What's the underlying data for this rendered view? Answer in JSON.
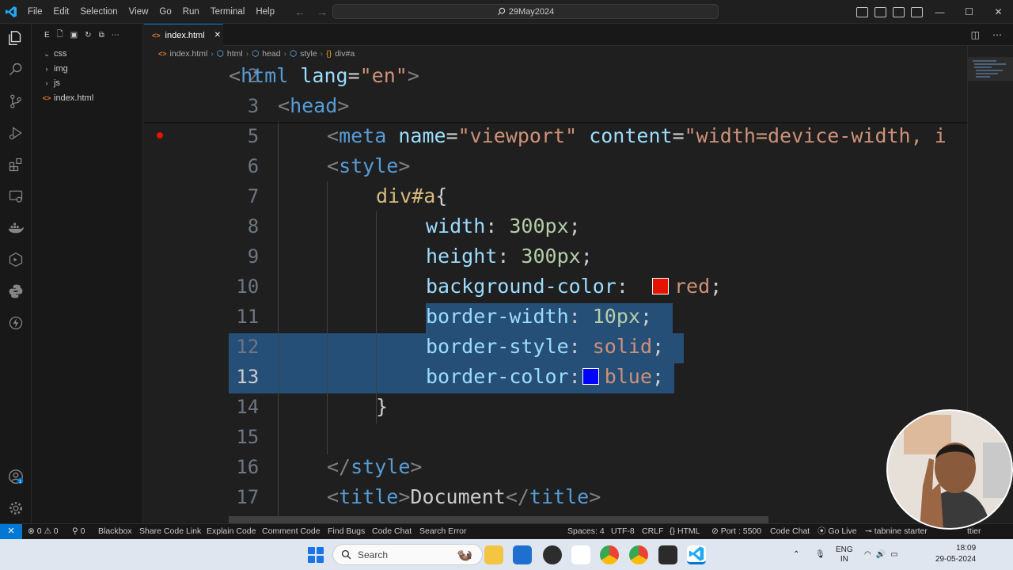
{
  "menu": [
    "File",
    "Edit",
    "Selection",
    "View",
    "Go",
    "Run",
    "Terminal",
    "Help"
  ],
  "command_center": "29May2024",
  "explorer": {
    "header_letter": "E",
    "items": [
      {
        "label": "css",
        "type": "folder"
      },
      {
        "label": "img",
        "type": "folder"
      },
      {
        "label": "js",
        "type": "folder"
      },
      {
        "label": "index.html",
        "type": "file"
      }
    ]
  },
  "tab": {
    "label": "index.html",
    "close": "✕"
  },
  "breadcrumb": [
    "index.html",
    "html",
    "head",
    "style",
    "div#a"
  ],
  "editor": {
    "lines": [
      {
        "n": "2"
      },
      {
        "n": "3"
      },
      {
        "n": "5"
      },
      {
        "n": "6"
      },
      {
        "n": "7"
      },
      {
        "n": "8"
      },
      {
        "n": "9"
      },
      {
        "n": "10"
      },
      {
        "n": "11"
      },
      {
        "n": "12"
      },
      {
        "n": "13"
      },
      {
        "n": "14"
      },
      {
        "n": "15"
      },
      {
        "n": "16"
      },
      {
        "n": "17"
      }
    ],
    "tokens": {
      "l2_tag": "html",
      "l2_attr": "lang",
      "l2_val": "\"en\"",
      "l3_tag": "head",
      "l5_tag": "meta",
      "l5_attr1": "name",
      "l5_val1": "\"viewport\"",
      "l5_attr2": "content",
      "l5_val2": "\"width=device-width, i",
      "l6_tag": "style",
      "l7_sel": "div#a",
      "l8_prop": "width",
      "l8_val": "300px",
      "l9_prop": "height",
      "l9_val": "300px",
      "l10_prop": "background-color",
      "l10_val": "red",
      "l11_prop": "border-width",
      "l11_val": "10px",
      "l12_prop": "border-style",
      "l12_val": "solid",
      "l13_prop": "border-color",
      "l13_val": "blue",
      "l16_tag": "style",
      "l17_tag": "title",
      "l17_text": "Document"
    },
    "swatch_red": "#e51400",
    "swatch_blue": "#0000ff"
  },
  "statusbar": {
    "errors": "⊗ 0 ⚠ 0",
    "ports": "0",
    "items_left": [
      "Blackbox",
      "Share Code Link",
      "Explain Code",
      "Comment Code",
      "Find Bugs",
      "Code Chat",
      "Search Error"
    ],
    "spaces": "Spaces: 4",
    "encoding": "UTF-8",
    "eol": "CRLF",
    "language": "HTML",
    "port": "Port : 5500",
    "code_chat": "Code Chat",
    "go_live": "Go Live",
    "tabnine": "tabnine starter",
    "prettier": "ttier"
  },
  "taskbar": {
    "search": "Search",
    "lang_top": "ENG",
    "lang_bottom": "IN",
    "time": "18:09",
    "date": "29-05-2024"
  },
  "accent": "#0078d4"
}
